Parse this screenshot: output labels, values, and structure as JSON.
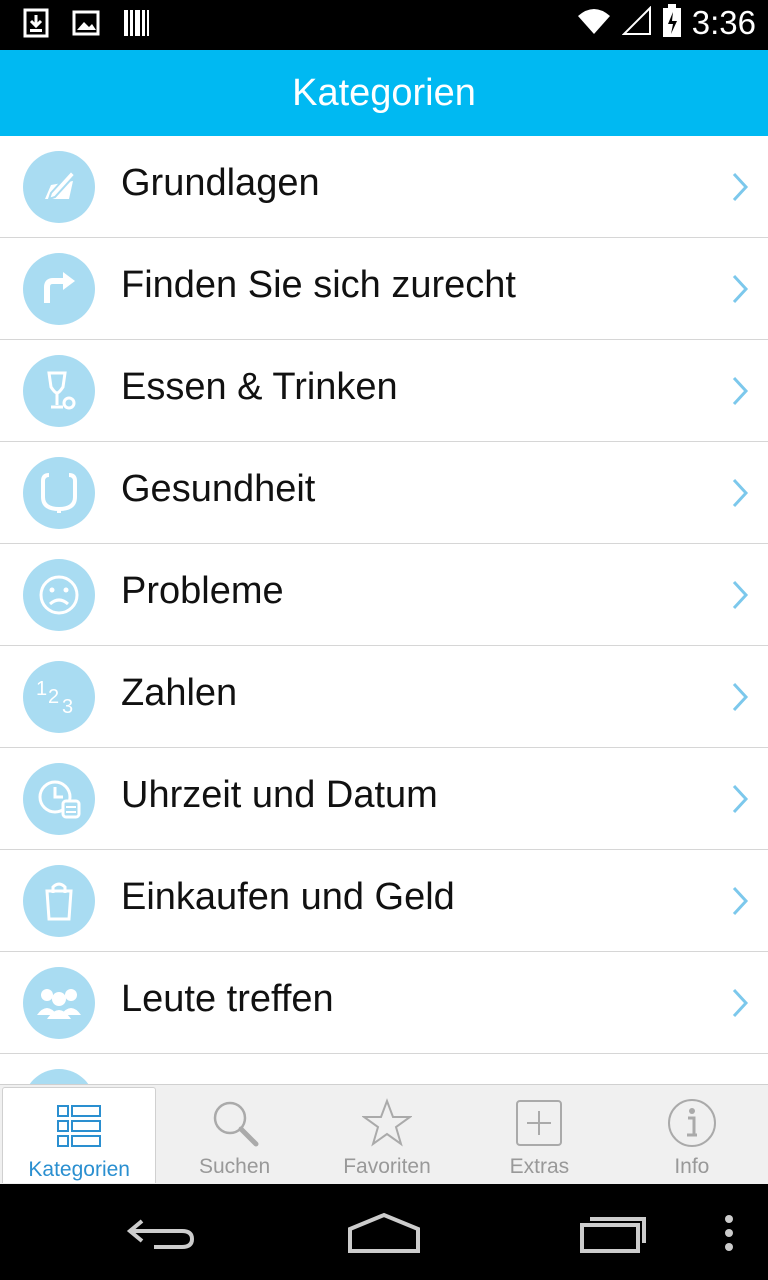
{
  "status": {
    "time": "3:36"
  },
  "appbar": {
    "title": "Kategorien"
  },
  "categories": [
    {
      "label": "Grundlagen",
      "icon": "pencil-paper-icon"
    },
    {
      "label": "Finden Sie sich zurecht",
      "icon": "turn-right-arrow-icon"
    },
    {
      "label": "Essen & Trinken",
      "icon": "glass-icon"
    },
    {
      "label": "Gesundheit",
      "icon": "stethoscope-icon"
    },
    {
      "label": "Probleme",
      "icon": "sad-face-icon"
    },
    {
      "label": "Zahlen",
      "icon": "numbers-icon"
    },
    {
      "label": "Uhrzeit und Datum",
      "icon": "clock-calendar-icon"
    },
    {
      "label": "Einkaufen und Geld",
      "icon": "shopping-bag-icon"
    },
    {
      "label": "Leute treffen",
      "icon": "people-icon"
    }
  ],
  "tabs": [
    {
      "label": "Kategorien",
      "icon": "list-grid-icon",
      "active": true
    },
    {
      "label": "Suchen",
      "icon": "search-icon",
      "active": false
    },
    {
      "label": "Favoriten",
      "icon": "star-icon",
      "active": false
    },
    {
      "label": "Extras",
      "icon": "plus-box-icon",
      "active": false
    },
    {
      "label": "Info",
      "icon": "info-icon",
      "active": false
    }
  ],
  "colors": {
    "accent": "#00b9f2",
    "icon_circle": "#a9dcf2",
    "active_tab": "#2a8fd0"
  }
}
